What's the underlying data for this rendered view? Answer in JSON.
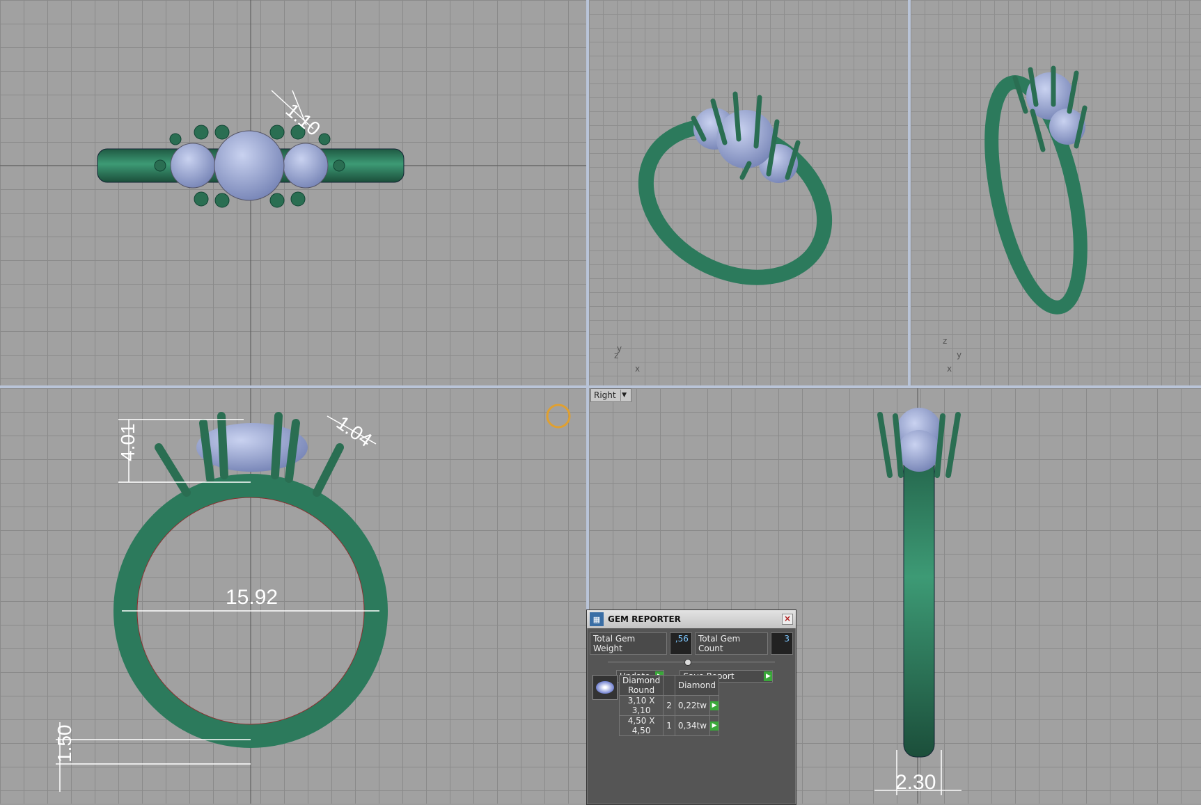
{
  "viewports": {
    "bottom_right_view_label": "Right"
  },
  "dimensions": {
    "top_prong": "1.10",
    "front_height": "4.01",
    "front_prong": "1.04",
    "inner_diameter": "15.92",
    "band_thickness": "1.50",
    "band_width": "2.30"
  },
  "axes": {
    "x": "x",
    "y": "y",
    "z": "z"
  },
  "gem_reporter": {
    "title": "GEM REPORTER",
    "total_weight_label": "Total Gem Weight",
    "total_weight_value": ",56",
    "total_count_label": "Total Gem Count",
    "total_count_value": "3",
    "update_label": "Update",
    "save_label": "Save Report",
    "table": {
      "headers": [
        "Diamond Round",
        "",
        "Diamond"
      ],
      "rows": [
        {
          "size": "3,10 X 3,10",
          "count": "2",
          "weight": "0,22tw"
        },
        {
          "size": "4,50 X 4,50",
          "count": "1",
          "weight": "0,34tw"
        }
      ]
    }
  },
  "colors": {
    "metal": "#2c7a5c",
    "gem": "#9aa8d6",
    "grid_bg": "#a1a1a1"
  }
}
